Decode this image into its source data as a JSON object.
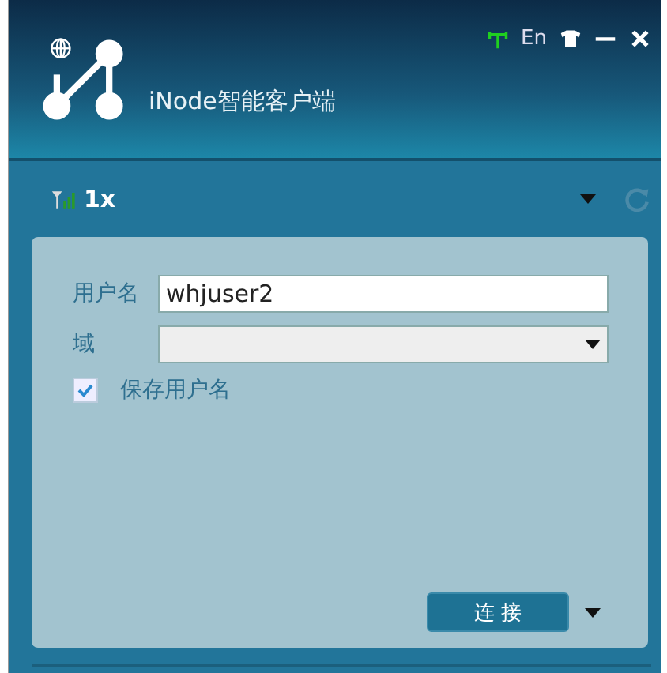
{
  "window": {
    "title": "iNode智能客户端",
    "language_button": "En"
  },
  "connection": {
    "name": "1x"
  },
  "form": {
    "username_label": "用户名",
    "username_value": "whjuser2",
    "domain_label": "域",
    "save_username": {
      "label": "保存用户名",
      "checked": true
    },
    "connect_button": "连 接"
  }
}
